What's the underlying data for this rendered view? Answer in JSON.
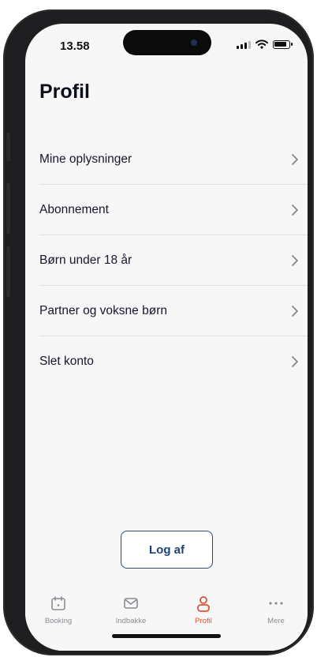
{
  "status": {
    "time": "13.58"
  },
  "page": {
    "title": "Profil"
  },
  "menu": {
    "items": [
      {
        "label": "Mine oplysninger"
      },
      {
        "label": "Abonnement"
      },
      {
        "label": "Børn under 18 år"
      },
      {
        "label": "Partner og voksne børn"
      },
      {
        "label": "Slet konto"
      }
    ]
  },
  "actions": {
    "logout_label": "Log af"
  },
  "tabbar": {
    "tabs": [
      {
        "label": "Booking",
        "icon": "calendar-icon"
      },
      {
        "label": "Indbakke",
        "icon": "mail-icon"
      },
      {
        "label": "Profil",
        "icon": "person-icon",
        "active": true
      },
      {
        "label": "Mere",
        "icon": "more-dots-icon"
      }
    ]
  },
  "colors": {
    "accent": "#e0522f",
    "primary": "#1f3f78",
    "inactive": "#8a8c93"
  }
}
